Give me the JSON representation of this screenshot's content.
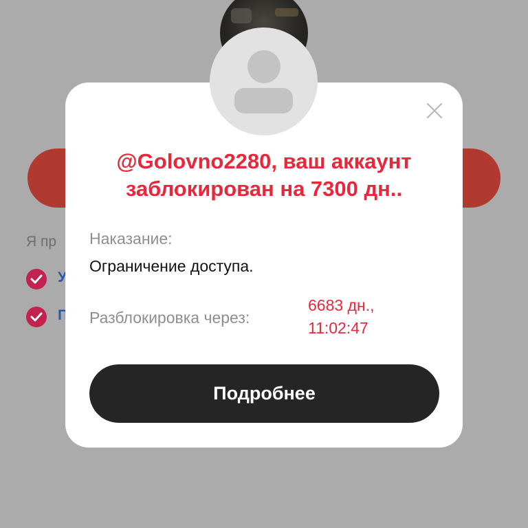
{
  "background": {
    "agree_label": "Я пр",
    "link_1": "У",
    "link_2": "П"
  },
  "modal": {
    "title_line_1": "@Golovno2280, ваш аккаунт",
    "title_line_2": "заблокирован на 7300 дн..",
    "penalty_label": "Наказание:",
    "penalty_value": "Ограничение доступа.",
    "unlock_label": "Разблокировка через:",
    "unlock_line_1": "6683 дн.,",
    "unlock_line_2": "11:02:47",
    "more_button": "Подробнее"
  },
  "icons": {
    "close": "close-icon",
    "avatar": "user-placeholder-icon",
    "check": "check-circle-icon"
  },
  "colors": {
    "accent_red": "#e8283a",
    "button_dark": "#252525",
    "check_pink": "#c2224f",
    "background_dim": "#ababab"
  }
}
